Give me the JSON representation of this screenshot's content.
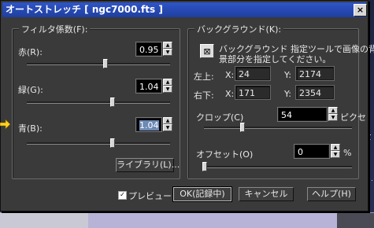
{
  "window": {
    "title": "オートストレッチ [ ngc7000.fts ]",
    "close_label": "×"
  },
  "filter": {
    "group_label": "フィルタ係数(F):",
    "red_label": "赤(R):",
    "red_value": "0.95",
    "green_label": "緑(G):",
    "green_value": "1.04",
    "blue_label": "青(B):",
    "blue_value": "1.04",
    "red_level": 0.55,
    "green_level": 0.6,
    "blue_level": 0.6,
    "library_button": "ライブラリ(L)..."
  },
  "background": {
    "group_label": "バックグラウンド(K):",
    "hint_line1": "バックグラウンド 指定ツールで画像の背",
    "hint_line2": "景部分を指定してください。",
    "upper_left_label": "左上:",
    "lower_right_label": "右下:",
    "x_label": "X:",
    "y_label": "Y:",
    "upper_left_x": "24",
    "upper_left_y": "2174",
    "lower_right_x": "171",
    "lower_right_y": "2354",
    "clip_label": "クロップ(C)",
    "clip_value": "54",
    "clip_unit": "ピクセ",
    "offset_label": "オフセット(O)",
    "offset_value": "0",
    "offset_unit": "%"
  },
  "footer": {
    "preview_label": "プレビュー(P)",
    "preview_checked": true,
    "ok_button": "OK(記録中)",
    "cancel_button": "キャンセル",
    "help_button": "ヘルプ(H)"
  },
  "icons": [
    "close-icon",
    "background-tool-icon",
    "pointer-arrow-icon",
    "spin-up-icon",
    "spin-down-icon"
  ]
}
